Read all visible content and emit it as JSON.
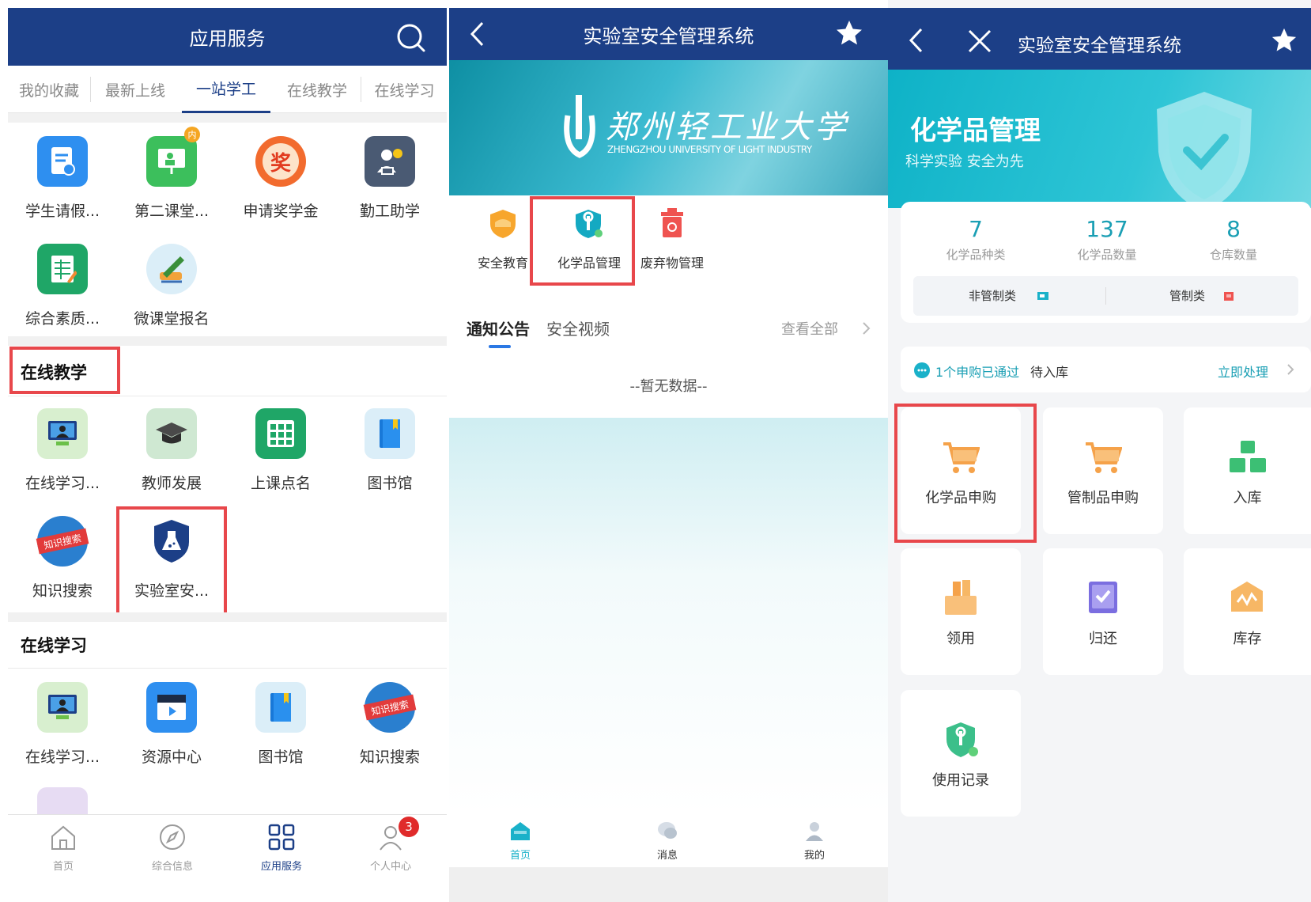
{
  "colors": {
    "nav_blue": "#1c3f87",
    "teal": "#10b9c7",
    "red_highlight": "#e8474b",
    "link_blue": "#2b78e4"
  },
  "panel1": {
    "header_title": "应用服务",
    "search_icon": "search-icon",
    "tabs": [
      "我的收藏",
      "最新上线",
      "一站学工",
      "在线教学",
      "在线学习"
    ],
    "active_tab": "一站学工",
    "section1_apps": [
      {
        "label": "学生请假...",
        "icon": "leave-form-icon"
      },
      {
        "label": "第二课堂...",
        "icon": "classroom-icon",
        "badge": "内"
      },
      {
        "label": "申请奖学金",
        "icon": "scholarship-icon",
        "glyph": "奖"
      },
      {
        "label": "勤工助学",
        "icon": "work-study-icon"
      },
      {
        "label": "综合素质...",
        "icon": "spreadsheet-icon"
      },
      {
        "label": "微课堂报名",
        "icon": "pen-signup-icon"
      }
    ],
    "section2_title": "在线教学",
    "section2_apps": [
      {
        "label": "在线学习...",
        "icon": "online-learning-icon"
      },
      {
        "label": "教师发展",
        "icon": "graduation-cap-icon"
      },
      {
        "label": "上课点名",
        "icon": "roll-call-icon"
      },
      {
        "label": "图书馆",
        "icon": "book-icon"
      },
      {
        "label": "知识搜索",
        "icon": "knowledge-search-icon",
        "tag": "知识搜索"
      },
      {
        "label": "实验室安...",
        "icon": "lab-flask-icon"
      }
    ],
    "section3_title": "在线学习",
    "section3_apps": [
      {
        "label": "在线学习...",
        "icon": "online-learning-icon"
      },
      {
        "label": "资源中心",
        "icon": "video-clapper-icon"
      },
      {
        "label": "图书馆",
        "icon": "book-icon"
      },
      {
        "label": "知识搜索",
        "icon": "knowledge-search-icon",
        "tag": "知识搜索"
      }
    ],
    "bottom_nav": [
      {
        "label": "首页",
        "icon": "home-icon"
      },
      {
        "label": "综合信息",
        "icon": "compass-icon"
      },
      {
        "label": "应用服务",
        "icon": "grid-apps-icon",
        "active": true
      },
      {
        "label": "个人中心",
        "icon": "user-icon",
        "badge": "3"
      }
    ]
  },
  "panel2": {
    "header_title": "实验室安全管理系统",
    "banner_calligraphy": "郑州轻工业大学",
    "banner_english": "ZHENGZHOU UNIVERSITY OF LIGHT INDUSTRY",
    "modules": [
      {
        "label": "安全教育",
        "icon": "orange-shield-icon"
      },
      {
        "label": "化学品管理",
        "icon": "teal-shield-wrench-icon"
      },
      {
        "label": "废弃物管理",
        "icon": "red-bin-icon"
      }
    ],
    "notice_tabs": [
      "通知公告",
      "安全视频"
    ],
    "view_all": "查看全部",
    "empty_text": "--暂无数据--",
    "bottom_nav": [
      {
        "label": "首页",
        "icon": "home-icon",
        "active": true
      },
      {
        "label": "消息",
        "icon": "message-icon"
      },
      {
        "label": "我的",
        "icon": "user-icon"
      }
    ]
  },
  "panel3": {
    "header_title": "实验室安全管理系统",
    "banner_title": "化学品管理",
    "banner_subtitle": "科学实验 安全为先",
    "stats": [
      {
        "value": "7",
        "label": "化学品种类"
      },
      {
        "value": "137",
        "label": "化学品数量"
      },
      {
        "value": "8",
        "label": "仓库数量"
      }
    ],
    "category_left": "非管制类",
    "category_right": "管制类",
    "notice_highlight": "1个申购已通过",
    "notice_rest": "待入库",
    "notice_action": "立即处理",
    "tiles": [
      {
        "label": "化学品申购",
        "icon": "cart-icon"
      },
      {
        "label": "管制品申购",
        "icon": "cart-icon"
      },
      {
        "label": "入库",
        "icon": "blocks-icon"
      },
      {
        "label": "领用",
        "icon": "box-icon"
      },
      {
        "label": "归还",
        "icon": "return-book-icon"
      },
      {
        "label": "库存",
        "icon": "inventory-icon"
      },
      {
        "label": "使用记录",
        "icon": "record-shield-icon"
      }
    ]
  }
}
